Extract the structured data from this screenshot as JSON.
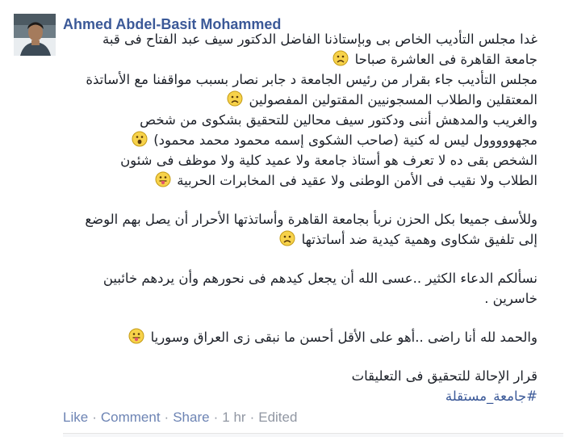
{
  "post": {
    "author": "Ahmed Abdel-Basit Mohammed",
    "lines": [
      "غدا مجلس التأديب الخاص بى وبإستاذنا الفاضل الدكتور سيف عبد الفتاح فى قبة",
      "جامعة القاهرة فى العاشرة صباحا",
      "مجلس التأديب جاء بقرار من رئيس الجامعة د جابر نصار بسبب مواقفنا مع الأساتذة",
      "المعتقلين والطلاب المسجونيين المقتولين المفصولين",
      "والغريب والمدهش أننى ودكتور سيف محالين للتحقيق بشكوى من شخص",
      "مجهووووول ليس له كنية (صاحب الشكوى إسمه محمود محمد محمود)",
      "الشخص بقى ده لا تعرف هو أستاذ جامعة ولا عميد كلية ولا موظف فى شئون",
      "الطلاب ولا نقيب فى الأمن الوطنى ولا عقيد فى المخابرات الحربية",
      "وللأسف جميعا بكل الحزن نربأ بجامعة القاهرة وأساتذتها الأحرار أن يصل بهم الوضع",
      "إلى تلفيق شكاوى وهمية كيدية ضد أساتذتها",
      "نسألكم الدعاء الكثير ..عسى الله أن يجعل كيدهم فى نحورهم وأن يردهم خائبين",
      "خاسرين .",
      "والحمد لله أنا راضى ..أهو على الأقل أحسن ما نبقى زى العراق وسوريا",
      "قرار الإحالة للتحقيق فى التعليقات"
    ],
    "hashtag": "#جامعة_مستقلة",
    "emoticons": [
      "frown-icon",
      "frown-icon",
      "gasp-icon",
      "tongue-icon",
      "frown-icon",
      "tongue-icon"
    ]
  },
  "actions": {
    "like": "Like",
    "comment": "Comment",
    "share": "Share",
    "separator": "·",
    "time": "1 hr",
    "edited": "Edited"
  },
  "colors": {
    "link": "#3b5998",
    "action_link": "#6d84b4",
    "meta": "#9197a3",
    "emoticon": "#f7d24a"
  }
}
